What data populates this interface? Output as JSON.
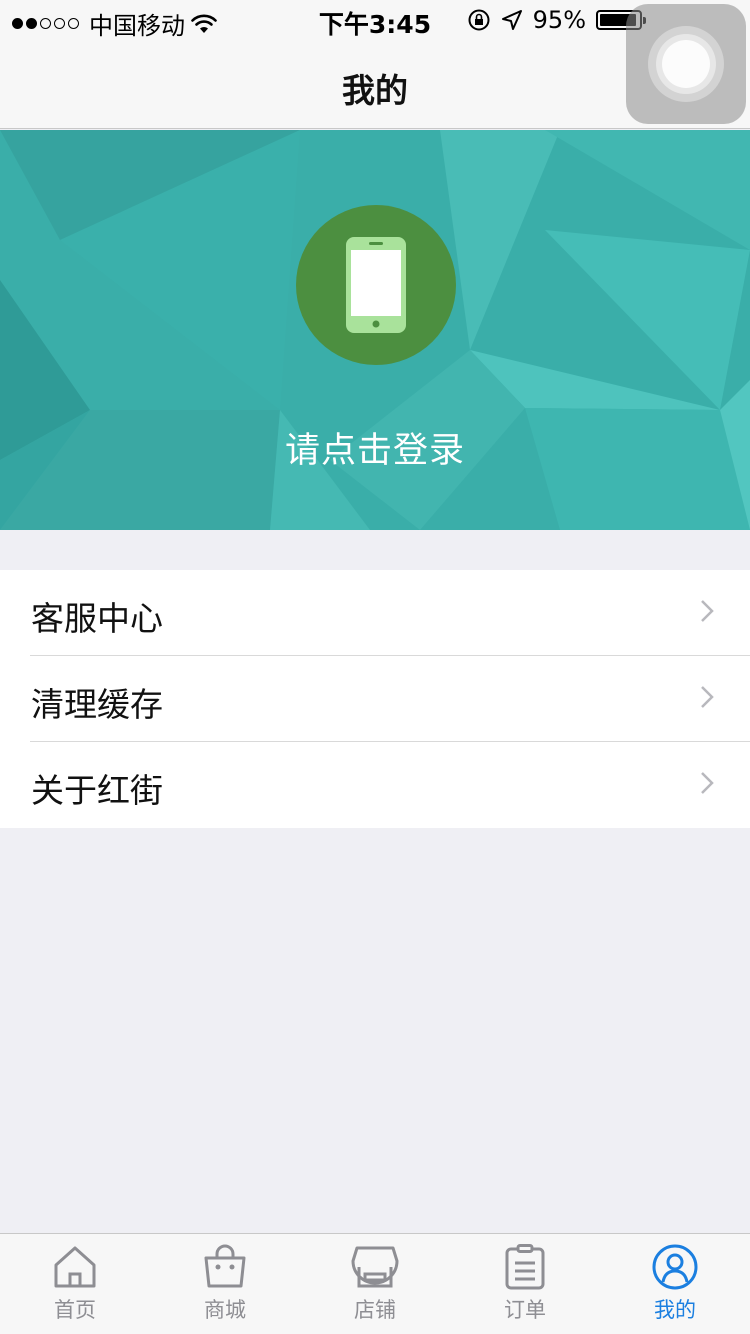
{
  "status_bar": {
    "carrier": "中国移动",
    "time": "下午3:45",
    "battery": "95%",
    "icons": [
      "signal-dots-icon",
      "wifi-icon",
      "rotation-lock-icon",
      "location-arrow-icon",
      "battery-icon"
    ]
  },
  "nav": {
    "title": "我的"
  },
  "banner": {
    "login_prompt": "请点击登录",
    "avatar_icon": "phone-icon",
    "colors": {
      "background": "#3aaea9",
      "avatar_circle": "#4c8f40",
      "phone": "#a9e29b"
    }
  },
  "menu": {
    "items": [
      {
        "label": "客服中心",
        "icon": "chevron-right-icon"
      },
      {
        "label": "清理缓存",
        "icon": "chevron-right-icon"
      },
      {
        "label": "关于红街",
        "icon": "chevron-right-icon"
      }
    ]
  },
  "tabs": [
    {
      "label": "首页",
      "icon": "home-icon",
      "active": false
    },
    {
      "label": "商城",
      "icon": "shopping-bag-icon",
      "active": false
    },
    {
      "label": "店铺",
      "icon": "store-icon",
      "active": false
    },
    {
      "label": "订单",
      "icon": "order-list-icon",
      "active": false
    },
    {
      "label": "我的",
      "icon": "user-icon",
      "active": true
    }
  ],
  "colors": {
    "accent": "#1b7fe0",
    "inactive_tab": "#8e8e93",
    "page_background": "#efeff4"
  }
}
